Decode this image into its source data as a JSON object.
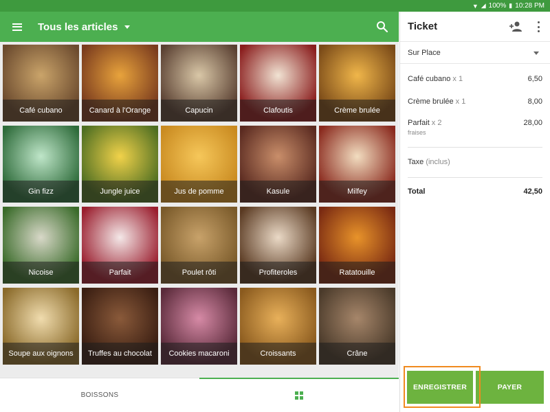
{
  "status_bar": {
    "battery": "100%",
    "time": "10:28 PM"
  },
  "app_bar": {
    "title": "Tous les articles"
  },
  "items": [
    {
      "name": "Café cubano"
    },
    {
      "name": "Canard à l'Orange"
    },
    {
      "name": "Capucin"
    },
    {
      "name": "Clafoutis"
    },
    {
      "name": "Crème brulée"
    },
    {
      "name": "Gin fizz"
    },
    {
      "name": "Jungle juice"
    },
    {
      "name": "Jus de pomme"
    },
    {
      "name": "Kasule"
    },
    {
      "name": "Milfey"
    },
    {
      "name": "Nicoise"
    },
    {
      "name": "Parfait"
    },
    {
      "name": "Poulet rôti"
    },
    {
      "name": "Profiteroles"
    },
    {
      "name": "Ratatouille"
    },
    {
      "name": "Soupe aux oignons"
    },
    {
      "name": "Truffes au chocolat"
    },
    {
      "name": "Cookies macaroni"
    },
    {
      "name": "Croissants"
    },
    {
      "name": "Crâne"
    }
  ],
  "bottom_tabs": {
    "drinks": "BOISSONS"
  },
  "ticket": {
    "title": "Ticket",
    "dining_option": "Sur Place",
    "lines": [
      {
        "name": "Café cubano",
        "qty": "x 1",
        "price": "6,50"
      },
      {
        "name": "Crème brulée",
        "qty": "x 1",
        "price": "8,00"
      },
      {
        "name": "Parfait",
        "qty": "x 2",
        "price": "28,00",
        "modifier": "fraises"
      }
    ],
    "tax_label": "Taxe",
    "tax_note": "(inclus)",
    "total_label": "Total",
    "total_value": "42,50"
  },
  "actions": {
    "save": "ENREGISTRER",
    "pay": "PAYER"
  },
  "colors": {
    "primary": "#4caf50",
    "status": "#3e9a3e",
    "button": "#6db33f",
    "highlight": "#f08a1e"
  }
}
